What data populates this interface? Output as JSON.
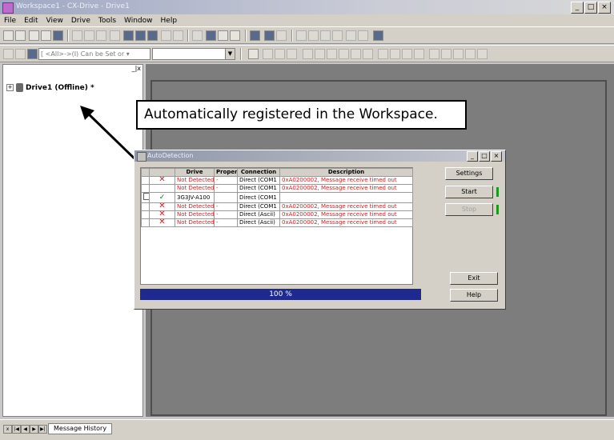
{
  "window": {
    "title": "Workspace1 - CX-Drive - Drive1",
    "controls": [
      "_",
      "□",
      "×"
    ]
  },
  "menu": [
    "File",
    "Edit",
    "View",
    "Drive",
    "Tools",
    "Window",
    "Help"
  ],
  "toolbar2": {
    "combo1_text": "[ <All>->(I) Can be Set or ▾",
    "combo2_text": ""
  },
  "workspace_pane": {
    "close_glyphs": "_|x",
    "tree_expand": "+",
    "tree_item": "Drive1 (Offline) *"
  },
  "callout": {
    "text": "Automatically registered in the Workspace."
  },
  "dialog": {
    "title": "AutoDetection",
    "controls": [
      "_",
      "□",
      "×"
    ],
    "columns": [
      "",
      "",
      "Drive",
      "Proper",
      "Connection",
      "Description"
    ],
    "rows": [
      {
        "status": "x",
        "drive": "Not Detected",
        "proper": "-",
        "connection": "Direct (COM1",
        "description": "0xA0200002, Message receive timed out"
      },
      {
        "status": "",
        "drive": "Not Detected",
        "proper": "-",
        "connection": "Direct (COM1",
        "description": "0xA0200002, Message receive timed out"
      },
      {
        "status": "check",
        "drive": "3G3JV-A100",
        "proper": "",
        "connection": "Direct (COM1",
        "description": ""
      },
      {
        "status": "x",
        "drive": "Not Detected",
        "proper": "-",
        "connection": "Direct (COM1",
        "description": "0xA0200002, Message receive timed out"
      },
      {
        "status": "x",
        "drive": "Not Detected",
        "proper": "-",
        "connection": "Direct (Ascii)",
        "description": "0xA0200002, Message receive timed out"
      },
      {
        "status": "x",
        "drive": "Not Detected",
        "proper": "-",
        "connection": "Direct (Ascii)",
        "description": "0xA0200002, Message receive timed out"
      }
    ],
    "progress": 100,
    "progress_label": "100 %",
    "buttons": {
      "settings": "Settings",
      "start": "Start",
      "stop": "Stop",
      "exit": "Exit",
      "help": "Help"
    }
  },
  "statusbar": {
    "tab_label": "Message History"
  },
  "colors": {
    "error_text": "#d02020",
    "ok_check": "#0a7a0a",
    "progress_bar": "#1f2a90",
    "mdi_background": "#7d7d7d"
  },
  "icons": [
    "new-icon",
    "open-icon",
    "save-icon",
    "print-icon",
    "cut-icon",
    "copy-icon",
    "paste-icon",
    "undo-icon",
    "online-icon",
    "transfer-icon",
    "monitor-icon",
    "zoom-icon",
    "help-icon",
    "gear-icon",
    "arrow-icon"
  ]
}
